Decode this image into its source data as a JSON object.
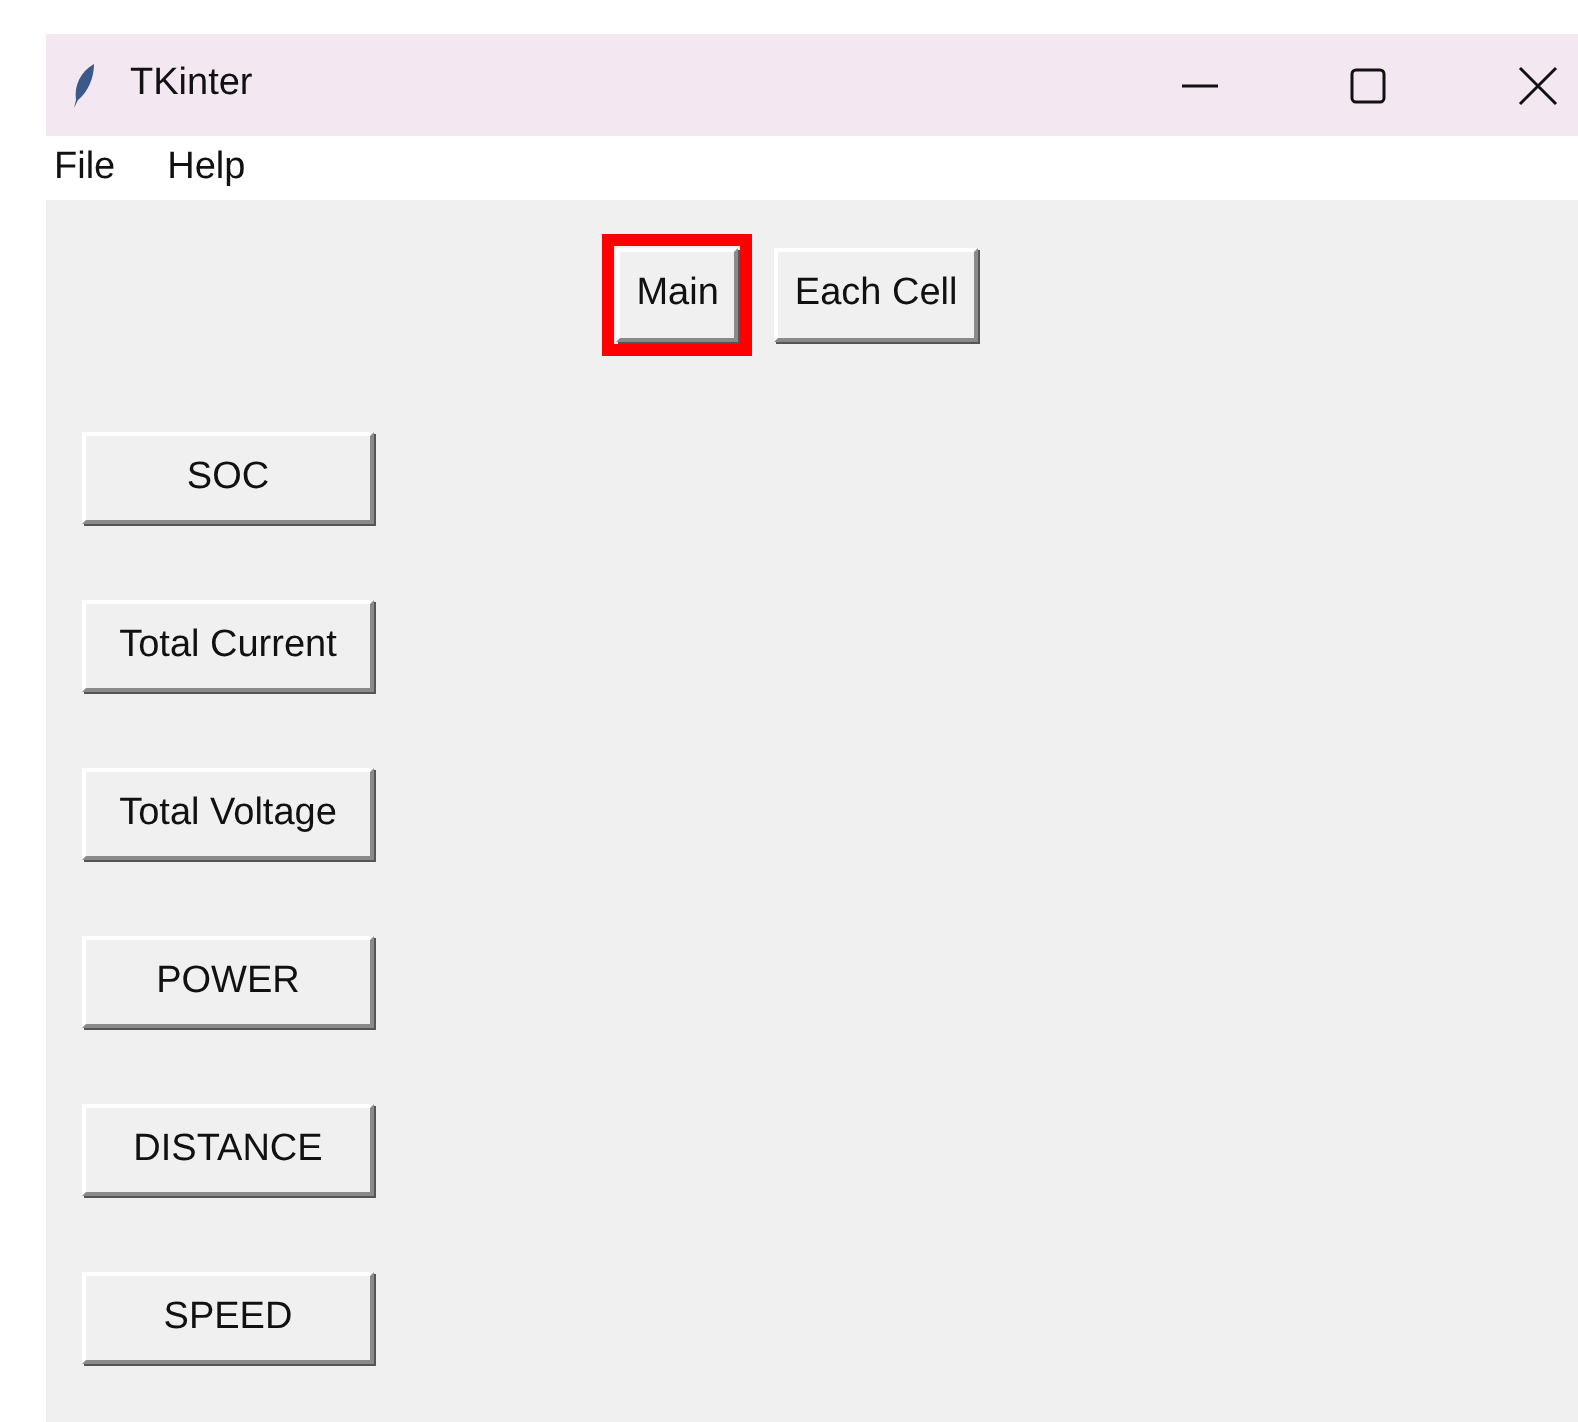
{
  "window": {
    "title": "TKinter"
  },
  "menu": [
    "File",
    "Help"
  ],
  "tabs": [
    {
      "label": "Main",
      "highlighted": true
    },
    {
      "label": "Each Cell",
      "highlighted": false
    }
  ],
  "buttons": [
    "SOC",
    "Total Current",
    "Total Voltage",
    "POWER",
    "DISTANCE",
    "SPEED"
  ]
}
